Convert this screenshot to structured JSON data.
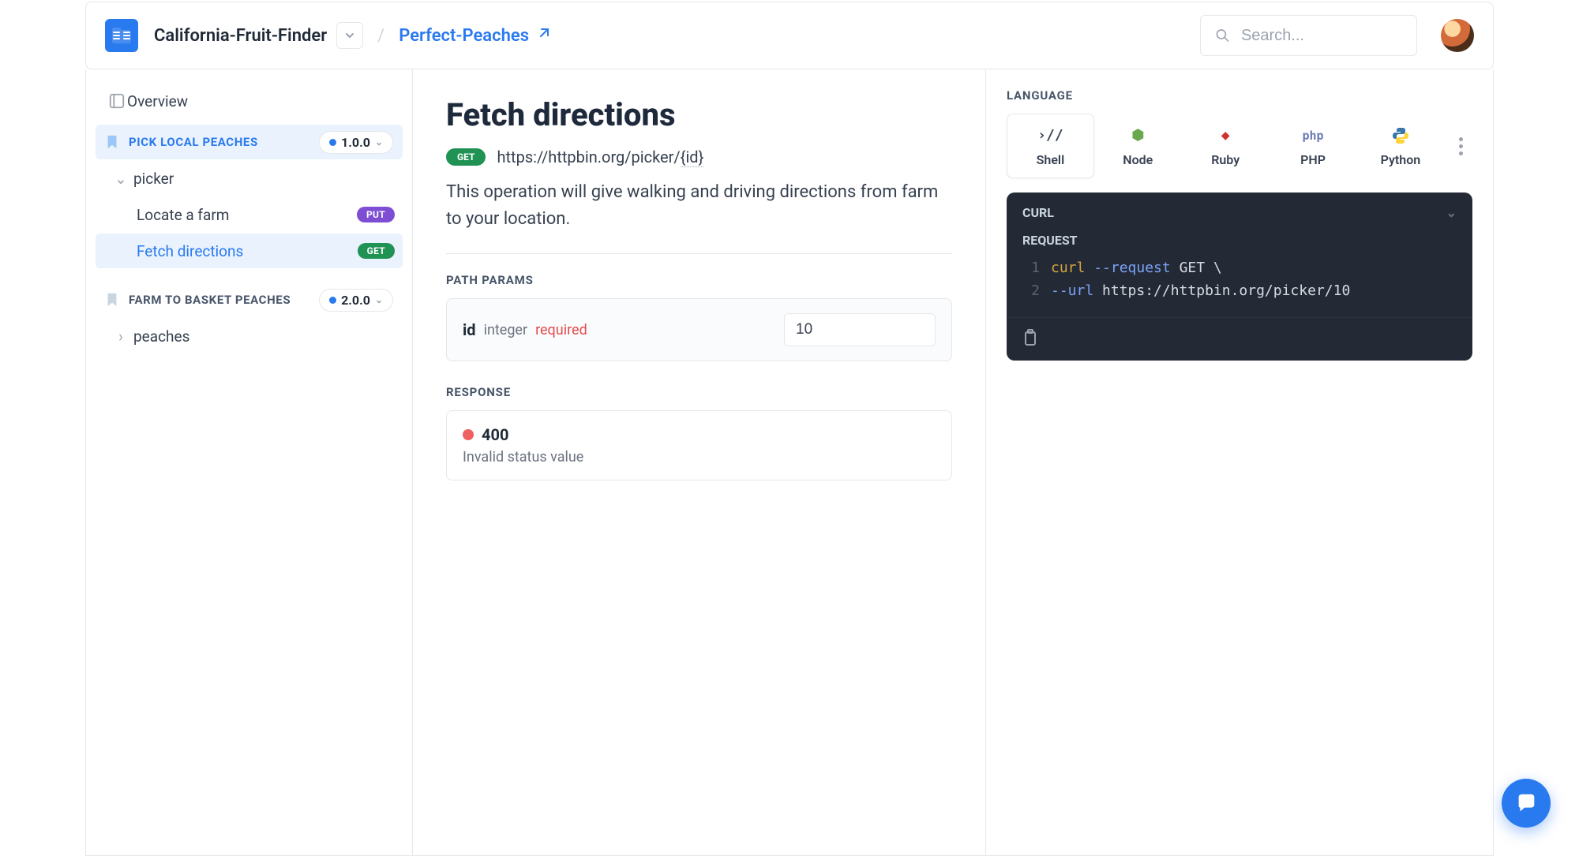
{
  "header": {
    "org": "California-Fruit-Finder",
    "project": "Perfect-Peaches",
    "search_placeholder": "Search..."
  },
  "sidebar": {
    "overview": "Overview",
    "sections": [
      {
        "title": "PICK LOCAL PEACHES",
        "version": "1.0.0",
        "active": true,
        "group": "picker",
        "items": [
          {
            "label": "Locate a farm",
            "method": "PUT"
          },
          {
            "label": "Fetch directions",
            "method": "GET",
            "active": true
          }
        ]
      },
      {
        "title": "FARM TO BASKET PEACHES",
        "version": "2.0.0",
        "group": "peaches"
      }
    ]
  },
  "main": {
    "title": "Fetch directions",
    "method": "GET",
    "url_prefix": "https://httpbin.org/picker/",
    "url_param": "{id}",
    "description": "This operation will give walking and driving directions from farm to your location.",
    "path_params_label": "PATH PARAMS",
    "param": {
      "name": "id",
      "type": "integer",
      "required": "required",
      "value": "10"
    },
    "response_label": "RESPONSE",
    "response": {
      "status": "400",
      "message": "Invalid status value"
    }
  },
  "right": {
    "language_label": "LANGUAGE",
    "languages": [
      "Shell",
      "Node",
      "Ruby",
      "PHP",
      "Python"
    ],
    "code_title": "CURL",
    "code_sub": "REQUEST",
    "code_lines": [
      {
        "n": "1",
        "kw": "curl",
        "opt": "--request",
        "txt": " GET \\"
      },
      {
        "n": "2",
        "kw": "",
        "opt": "     --url",
        "txt": " https://httpbin.org/picker/10"
      }
    ]
  }
}
